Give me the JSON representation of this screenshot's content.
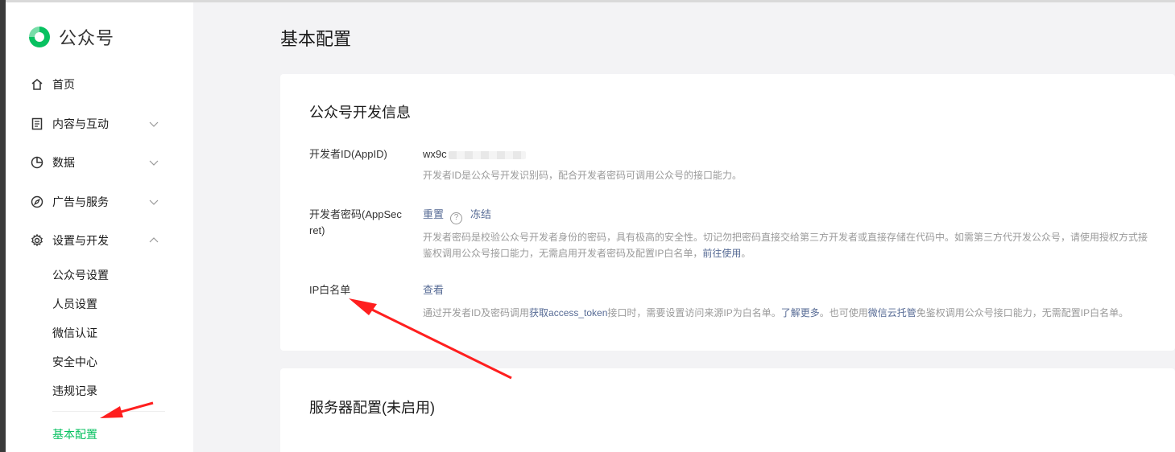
{
  "brand": {
    "name": "公众号",
    "accent": "#07c160"
  },
  "sidebar": {
    "items": [
      {
        "label": "首页",
        "icon": "home-icon"
      },
      {
        "label": "内容与互动",
        "icon": "document-icon"
      },
      {
        "label": "数据",
        "icon": "pie-chart-icon"
      },
      {
        "label": "广告与服务",
        "icon": "compass-icon"
      },
      {
        "label": "设置与开发",
        "icon": "gear-icon"
      }
    ],
    "sub_items": [
      "公众号设置",
      "人员设置",
      "微信认证",
      "安全中心",
      "违规记录",
      "基本配置"
    ]
  },
  "page": {
    "title": "基本配置"
  },
  "dev_info": {
    "title": "公众号开发信息",
    "appid_label": "开发者ID(AppID)",
    "appid_value": "wx9c",
    "appid_desc": "开发者ID是公众号开发识别码，配合开发者密码可调用公众号的接口能力。",
    "secret_label_line1": "开发者密码(AppSec",
    "secret_label_line2": "ret)",
    "secret_reset": "重置",
    "secret_help": "?",
    "secret_freeze": "冻结",
    "secret_desc_line1": "开发者密码是校验公众号开发者身份的密码，具有极高的安全性。切记勿把密码直接交给第三方开发者或直接存储在代码中。如需第三方代开发公众号，请使用授权方式接",
    "secret_desc_line2": "鉴权调用公众号接口能力，无需启用开发者密码及配置IP白名单，",
    "secret_desc_link": "前往使用",
    "secret_desc_end": "。",
    "ip_label": "IP白名单",
    "ip_view": "查看",
    "ip_desc_1": "通过开发者ID及密码调用",
    "ip_desc_link1": "获取access_token",
    "ip_desc_2": "接口时，需要设置访问来源IP为白名单。",
    "ip_desc_link2": "了解更多",
    "ip_desc_3": "。也可使用",
    "ip_desc_link3": "微信云托管",
    "ip_desc_4": "免鉴权调用公众号接口能力，无需配置IP白名单。"
  },
  "server_config": {
    "title": "服务器配置(未启用)"
  },
  "annotation": {
    "arrow_color": "#ff1f1f"
  }
}
